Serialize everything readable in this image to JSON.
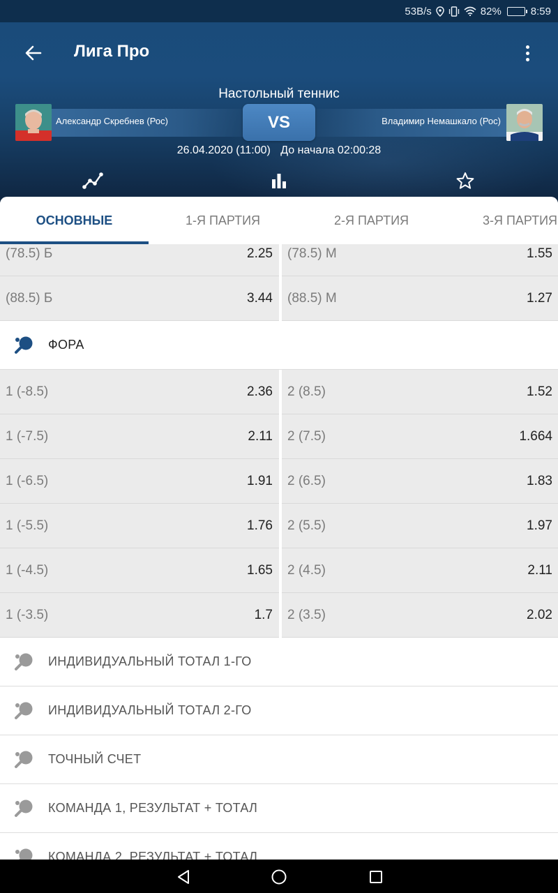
{
  "status_bar": {
    "speed": "53B/s",
    "battery_percent": "82%",
    "time": "8:59"
  },
  "header": {
    "title": "Лига Про",
    "sport": "Настольный теннис",
    "player1": "Александр Скребнев (Рос)",
    "player2": "Владимир Немашкало (Рос)",
    "vs": "VS",
    "date": "26.04.2020 (11:00)",
    "countdown": "До начала 02:00:28"
  },
  "tabs": [
    {
      "label": "ОСНОВНЫЕ",
      "active": true
    },
    {
      "label": "1-Я ПАРТИЯ",
      "active": false
    },
    {
      "label": "2-Я ПАРТИЯ",
      "active": false
    },
    {
      "label": "3-Я ПАРТИЯ",
      "active": false
    }
  ],
  "totals": [
    {
      "left_label": "(78.5) Б",
      "left_value": "2.25",
      "right_label": "(78.5) М",
      "right_value": "1.55"
    },
    {
      "left_label": "(88.5) Б",
      "left_value": "3.44",
      "right_label": "(88.5) М",
      "right_value": "1.27"
    }
  ],
  "handicap_section": {
    "label": "ФОРА"
  },
  "handicap": [
    {
      "left_label": "1 (-8.5)",
      "left_value": "2.36",
      "right_label": "2 (8.5)",
      "right_value": "1.52"
    },
    {
      "left_label": "1 (-7.5)",
      "left_value": "2.11",
      "right_label": "2 (7.5)",
      "right_value": "1.664"
    },
    {
      "left_label": "1 (-6.5)",
      "left_value": "1.91",
      "right_label": "2 (6.5)",
      "right_value": "1.83"
    },
    {
      "left_label": "1 (-5.5)",
      "left_value": "1.76",
      "right_label": "2 (5.5)",
      "right_value": "1.97"
    },
    {
      "left_label": "1 (-4.5)",
      "left_value": "1.65",
      "right_label": "2 (4.5)",
      "right_value": "2.11"
    },
    {
      "left_label": "1 (-3.5)",
      "left_value": "1.7",
      "right_label": "2 (3.5)",
      "right_value": "2.02"
    }
  ],
  "collapsed_sections": [
    {
      "label": "ИНДИВИДУАЛЬНЫЙ ТОТАЛ 1-ГО"
    },
    {
      "label": "ИНДИВИДУАЛЬНЫЙ ТОТАЛ 2-ГО"
    },
    {
      "label": "ТОЧНЫЙ СЧЕТ"
    },
    {
      "label": "КОМАНДА 1, РЕЗУЛЬТАТ + ТОТАЛ"
    },
    {
      "label": "КОМАНДА 2, РЕЗУЛЬТАТ + ТОТАЛ"
    }
  ],
  "colors": {
    "header_blue": "#1b4c7c",
    "accent": "#1d4f83",
    "odds_bg": "#ebebeb"
  },
  "icons": {
    "back": "arrow-left-icon",
    "menu": "more-vert-icon",
    "stats_line": "line-chart-icon",
    "stats_bar": "bar-chart-icon",
    "favorite": "star-outline-icon",
    "section": "table-tennis-paddle-icon"
  }
}
